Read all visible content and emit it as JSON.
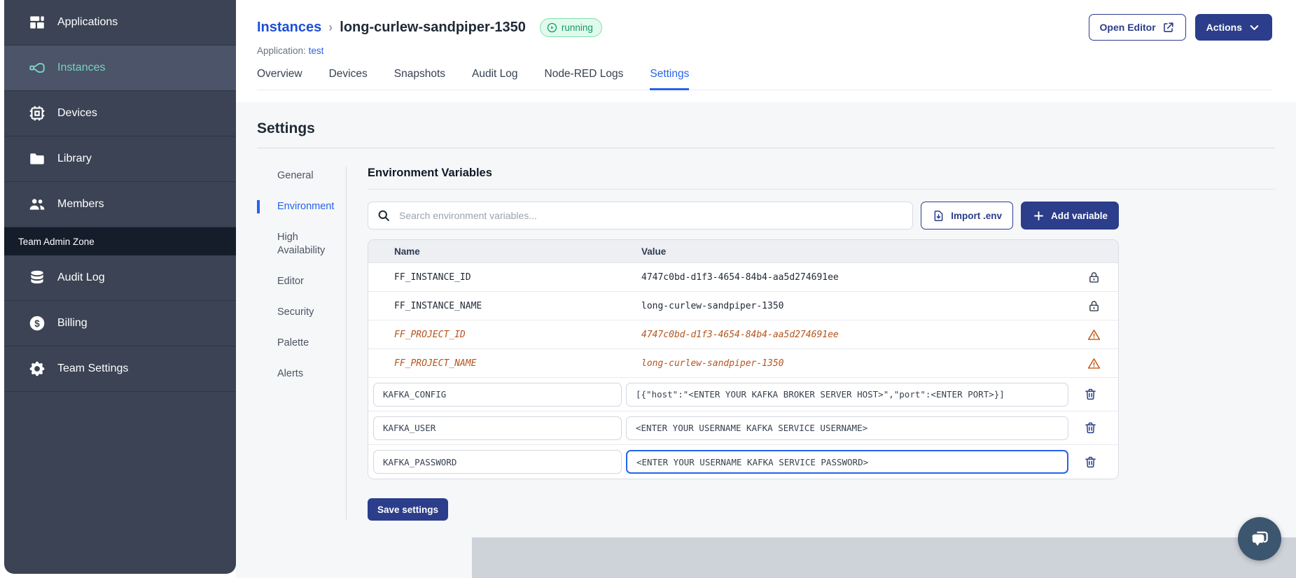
{
  "sidebar": {
    "items": [
      {
        "label": "Applications",
        "icon": "applications",
        "active": false
      },
      {
        "label": "Instances",
        "icon": "instances",
        "active": true
      },
      {
        "label": "Devices",
        "icon": "devices",
        "active": false
      },
      {
        "label": "Library",
        "icon": "library",
        "active": false
      },
      {
        "label": "Members",
        "icon": "members",
        "active": false
      }
    ],
    "section_label": "Team Admin Zone",
    "admin_items": [
      {
        "label": "Audit Log",
        "icon": "audit",
        "active": false
      },
      {
        "label": "Billing",
        "icon": "billing",
        "active": false
      },
      {
        "label": "Team Settings",
        "icon": "cog",
        "active": false
      }
    ]
  },
  "header": {
    "breadcrumb_root": "Instances",
    "breadcrumb_separator": "›",
    "instance_name": "long-curlew-sandpiper-1350",
    "status_badge": "running",
    "application_label": "Application:",
    "application_name": "test",
    "open_editor_label": "Open Editor",
    "actions_label": "Actions"
  },
  "tabs": [
    {
      "label": "Overview",
      "active": false
    },
    {
      "label": "Devices",
      "active": false
    },
    {
      "label": "Snapshots",
      "active": false
    },
    {
      "label": "Audit Log",
      "active": false
    },
    {
      "label": "Node-RED Logs",
      "active": false
    },
    {
      "label": "Settings",
      "active": true
    }
  ],
  "settings": {
    "title": "Settings",
    "nav": [
      "General",
      "Environment",
      "High Availability",
      "Editor",
      "Security",
      "Palette",
      "Alerts"
    ],
    "active_nav": "Environment"
  },
  "env": {
    "title": "Environment Variables",
    "search_placeholder": "Search environment variables...",
    "import_label": "Import .env",
    "add_label": "Add variable",
    "columns": {
      "name": "Name",
      "value": "Value"
    },
    "rows": [
      {
        "name": "FF_INSTANCE_ID",
        "value": "4747c0bd-d1f3-4654-84b4-aa5d274691ee",
        "type": "locked"
      },
      {
        "name": "FF_INSTANCE_NAME",
        "value": "long-curlew-sandpiper-1350",
        "type": "locked"
      },
      {
        "name": "FF_PROJECT_ID",
        "value": "4747c0bd-d1f3-4654-84b4-aa5d274691ee",
        "type": "deprecated"
      },
      {
        "name": "FF_PROJECT_NAME",
        "value": "long-curlew-sandpiper-1350",
        "type": "deprecated"
      },
      {
        "name": "KAFKA_CONFIG",
        "value": "[{\"host\":\"<ENTER YOUR KAFKA BROKER SERVER HOST>\",\"port\":<ENTER PORT>}]",
        "type": "editable",
        "focused": false
      },
      {
        "name": "KAFKA_USER",
        "value": "<ENTER YOUR USERNAME KAFKA SERVICE USERNAME>",
        "type": "editable",
        "focused": false
      },
      {
        "name": "KAFKA_PASSWORD",
        "value": "<ENTER YOUR USERNAME KAFKA SERVICE PASSWORD>",
        "type": "editable",
        "focused": true
      }
    ],
    "save_label": "Save settings"
  },
  "colors": {
    "sidebar_bg": "#3b4354",
    "sidebar_active_bg": "#4b5468",
    "sidebar_active_text": "#79d2c3",
    "admin_zone_bg": "#151c2a",
    "primary_navy": "#2b3d8b",
    "link_blue": "#2563eb",
    "breadcrumb_blue": "#1d4fd8",
    "running_green": "#0d9b6c",
    "running_bg": "#e0faec",
    "deprecated_orange": "#b5541d",
    "content_bg": "#f6f7f9",
    "bottom_band": "#ced2d9",
    "chat_fab": "#3d566f"
  }
}
